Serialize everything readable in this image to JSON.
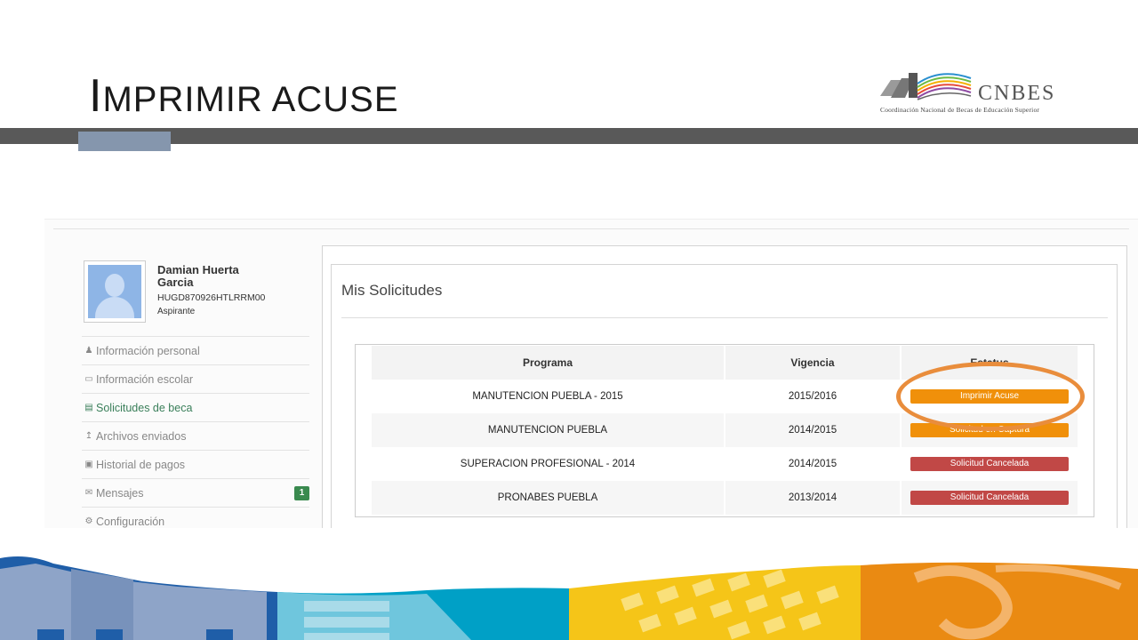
{
  "slide": {
    "title_cap": "I",
    "title_rest": "mprimir acuse"
  },
  "logo": {
    "name": "CNBES",
    "subtitle": "Coordinación Nacional de Becas de Educación Superior"
  },
  "user": {
    "name": "Damian Huerta Garcia",
    "curp": "HUGD870926HTLRRM00",
    "role": "Aspirante"
  },
  "menu": {
    "items": [
      {
        "label": "Información personal",
        "icon": "user-icon"
      },
      {
        "label": "Información escolar",
        "icon": "book-icon"
      },
      {
        "label": "Solicitudes de beca",
        "icon": "document-icon"
      },
      {
        "label": "Archivos enviados",
        "icon": "upload-icon"
      },
      {
        "label": "Historial de pagos",
        "icon": "money-icon"
      },
      {
        "label": "Mensajes",
        "icon": "envelope-icon",
        "badge": "1"
      },
      {
        "label": "Configuración",
        "icon": "gears-icon"
      }
    ],
    "active_index": 2
  },
  "panel": {
    "title": "Mis Solicitudes"
  },
  "table": {
    "headers": [
      "Programa",
      "Vigencia",
      "Estatus"
    ],
    "rows": [
      {
        "programa": "MANUTENCION PUEBLA - 2015",
        "vigencia": "2015/2016",
        "estatus": "Imprimir Acuse"
      },
      {
        "programa": "MANUTENCION PUEBLA",
        "vigencia": "2014/2015",
        "estatus": "Solicitud en Captura"
      },
      {
        "programa": "SUPERACION PROFESIONAL - 2014",
        "vigencia": "2014/2015",
        "estatus": "Solicitud Cancelada"
      },
      {
        "programa": "PRONABES PUEBLA",
        "vigencia": "2013/2014",
        "estatus": "Solicitud Cancelada"
      }
    ]
  },
  "colors": {
    "status_orange": "#f0900a",
    "status_red": "#c14846",
    "highlight": "#e98d3c",
    "active_menu": "#3a7f5a",
    "bar_dark": "#595959",
    "bar_accent": "#8596ad"
  }
}
